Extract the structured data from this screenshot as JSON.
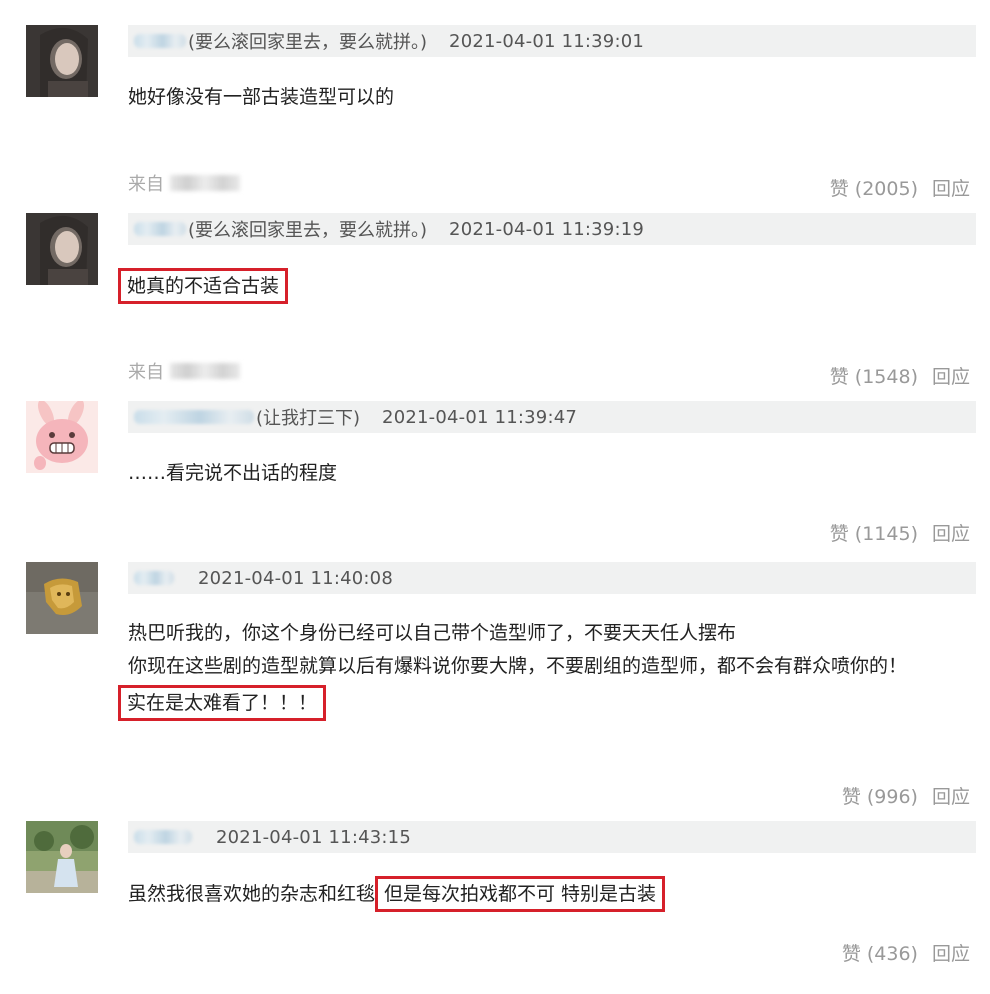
{
  "comments": [
    {
      "tag": "(要么滚回家里去，要么就拼。)",
      "time": "2021-04-01 11:39:01",
      "lines": [
        "她好像没有一部古装造型可以的"
      ],
      "from_label": "来自",
      "likes": "赞 (2005)",
      "reply": "回应"
    },
    {
      "tag": "(要么滚回家里去，要么就拼。)",
      "time": "2021-04-01 11:39:19",
      "lines": [
        "她真的不适合古装"
      ],
      "from_label": "来自",
      "likes": "赞 (1548)",
      "reply": "回应"
    },
    {
      "tag": "(让我打三下)",
      "time": "2021-04-01 11:39:47",
      "lines": [
        "……看完说不出话的程度"
      ],
      "likes": "赞 (1145)",
      "reply": "回应"
    },
    {
      "tag": "",
      "time": "2021-04-01 11:40:08",
      "lines": [
        "热巴听我的，你这个身份已经可以自己带个造型师了，不要天天任人摆布",
        "你现在这些剧的造型就算以后有爆料说你要大牌，不要剧组的造型师，都不会有群众喷你的！",
        "实在是太难看了！！！"
      ],
      "likes": "赞 (996)",
      "reply": "回应"
    },
    {
      "tag": "",
      "time": "2021-04-01 11:43:15",
      "text_plain": "虽然我很喜欢她的杂志和红毯",
      "text_highlight": "但是每次拍戏都不可 特别是古装",
      "likes": "赞 (436)",
      "reply": "回应"
    }
  ],
  "colors": {
    "highlight_border": "#d6202a",
    "header_bg": "#f0f1f1",
    "muted_text": "#999999"
  }
}
